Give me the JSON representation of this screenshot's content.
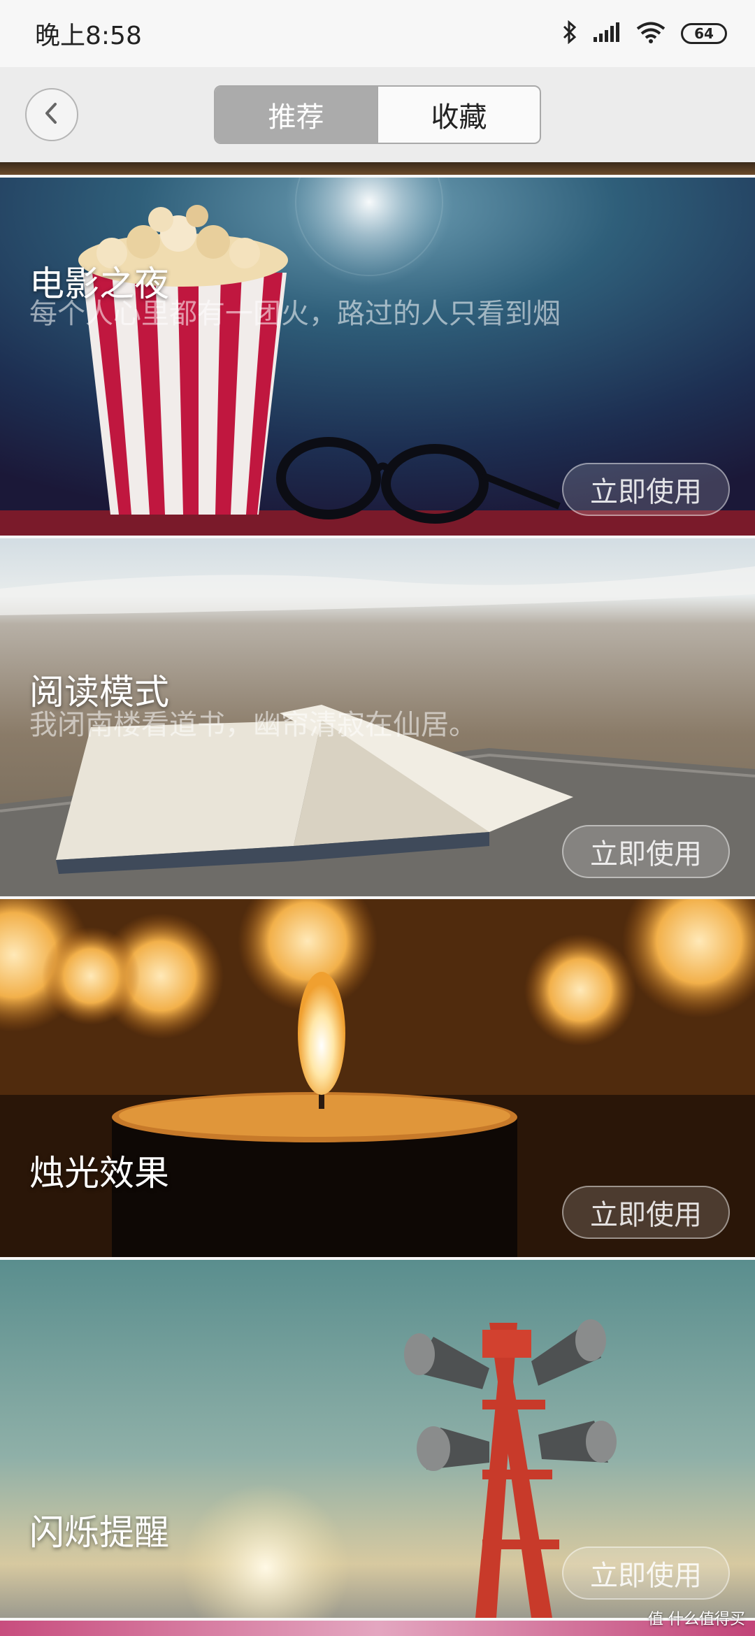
{
  "status_bar": {
    "time": "晚上8:58",
    "battery": "64"
  },
  "header": {
    "tabs": [
      {
        "label": "推荐",
        "active": true
      },
      {
        "label": "收藏",
        "active": false
      }
    ]
  },
  "cards": [
    {
      "title": "电影之夜",
      "subtitle": "每个人心里都有一团火，路过的人只看到烟",
      "button": "立即使用"
    },
    {
      "title": "阅读模式",
      "subtitle": "我闭南楼看道书，幽帘清寂在仙居。",
      "button": "立即使用"
    },
    {
      "title": "烛光效果",
      "subtitle": "",
      "button": "立即使用"
    },
    {
      "title": "闪烁提醒",
      "subtitle": "",
      "button": "立即使用"
    }
  ],
  "watermark": "值 什么值得买",
  "icons": [
    "back-arrow-icon",
    "bluetooth-icon",
    "signal-icon",
    "wifi-icon",
    "battery-icon"
  ]
}
